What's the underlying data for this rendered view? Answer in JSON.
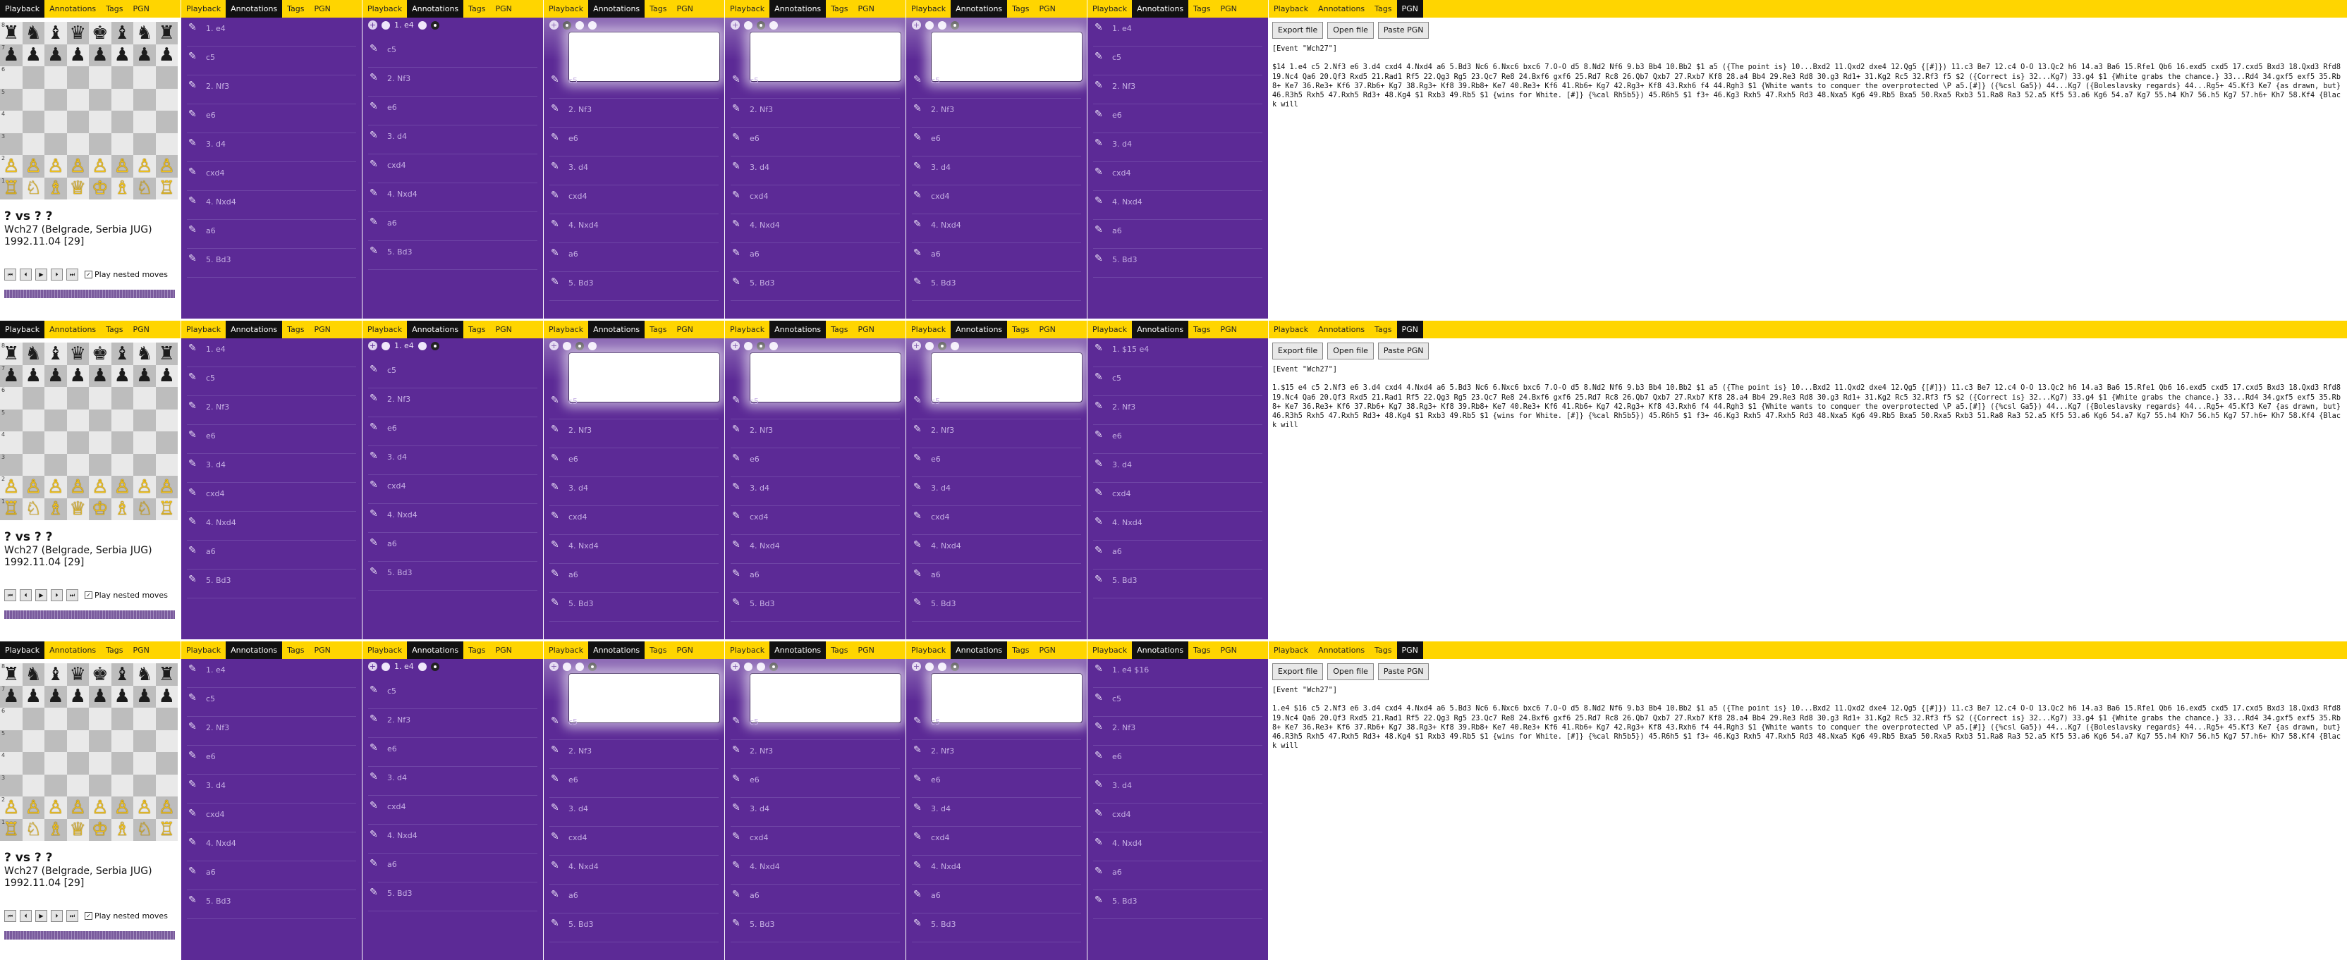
{
  "tabs": [
    "Playback",
    "Annotations",
    "Tags",
    "PGN"
  ],
  "colors": {
    "tab_bar": "#ffd500",
    "tab_active": "#111111",
    "annotation_bg": "#5c2a96",
    "square_light": "#e9e9e9",
    "square_dark": "#bdbdbd"
  },
  "playback": {
    "players": "? vs ? ?",
    "event": "Wch27 (Belgrade, Serbia JUG)",
    "date": "1992.11.04 [29]",
    "buttons": [
      "first",
      "prev",
      "play",
      "next",
      "last"
    ],
    "nested_label": "Play nested moves",
    "nested_checked": true
  },
  "annotation_moves": [
    "1. e4",
    "c5",
    "2. Nf3",
    "e6",
    "3. d4",
    "cxd4",
    "4. Nxd4",
    "a6",
    "5. Bd3"
  ],
  "annotation_header_nag": "$14",
  "pgn": {
    "buttons": {
      "export": "Export file",
      "open": "Open file",
      "paste": "Paste PGN"
    },
    "event_line": "[Event \"Wch27\"]",
    "moves_suffix": " c5 2.Nf3 e6 3.d4 cxd4 4.Nxd4 a6 5.Bd3 Nc6 6.Nxc6 bxc6 7.O-O d5 8.Nd2 Nf6 9.b3 Bb4 10.Bb2 $1 a5 ({The point is} 10...Bxd2 11.Qxd2 dxe4 12.Qg5 {[#]}) 11.c3 Be7 12.c4 O-O 13.Qc2 h6 14.a3 Ba6 15.Rfe1 Qb6 16.exd5 cxd5 17.cxd5 Bxd3 18.Qxd3 Rfd8 19.Nc4 Qa6 20.Qf3 Rxd5 21.Rad1 Rf5 22.Qg3 Rg5 23.Qc7 Re8 24.Bxf6 gxf6 25.Rd7 Rc8 26.Qb7 Qxb7 27.Rxb7 Kf8 28.a4 Bb4 29.Re3 Rd8 30.g3 Rd1+ 31.Kg2 Rc5 32.Rf3 f5 $2 ({Correct is} 32...Kg7) 33.g4 $1 {White grabs the chance.} 33...Rd4 34.gxf5 exf5 35.Rb8+ Ke7 36.Re3+ Kf6 37.Rb6+ Kg7 38.Rg3+ Kf8 39.Rb8+ Ke7 40.Re3+ Kf6 41.Rb6+ Kg7 42.Rg3+ Kf8 43.Rxh6 f4 44.Rgh3 $1 {White wants to conquer the overprotected \\P a5.[#]} ({%csl Ga5}) 44...Kg7 ({Boleslavsky regards} 44...Rg5+ 45.Kf3 Ke7 {as drawn, but} 46.R3h5 Rxh5 47.Rxh5 Rd3+ 48.Kg4 $1 Rxb3 49.Rb5 $1 {wins for White. [#]} {%cal Rh5b5}) 45.R6h5 $1 f3+ 46.Kg3 Rxh5 47.Rxh5 Rd3 48.Nxa5 Kg6 49.Rb5 Bxa5 50.Rxa5 Rxb3 51.Ra8 Ra3 52.a5 Kf5 53.a6 Kg6 54.a7 Kg7 55.h4 Kh7 56.h5 Kg7 57.h6+ Kh7 58.Kf4 {Black will",
    "rows": [
      {
        "prefix": "$14 1.e4"
      },
      {
        "prefix": "1.$15 e4"
      },
      {
        "prefix": "1.e4 $16"
      }
    ]
  },
  "frames_rows": [
    {
      "annotations_variants": [
        {
          "header_state": "nag",
          "header_text": "$14 1. e4",
          "first_move": "1. e4"
        },
        {
          "header_state": "dots",
          "active_dot": 2,
          "first_move": "1. e4"
        },
        {
          "header_state": "editor",
          "active_dot": 0
        },
        {
          "header_state": "editor",
          "active_dot": 1
        },
        {
          "header_state": "editor",
          "active_dot": 2
        },
        {
          "header_state": "nag",
          "header_text": "$14 1. e4",
          "first_move": "1. e4"
        }
      ]
    },
    {
      "annotations_variants": [
        {
          "header_state": "none",
          "first_move": "1. e4"
        },
        {
          "header_state": "dots",
          "active_dot": 2,
          "first_move": "1. e4"
        },
        {
          "header_state": "editor",
          "active_dot": 1
        },
        {
          "header_state": "editor",
          "active_dot": 1
        },
        {
          "header_state": "editor",
          "active_dot": 1
        },
        {
          "header_state": "none",
          "first_move": "1. $15 e4"
        }
      ]
    },
    {
      "annotations_variants": [
        {
          "header_state": "none",
          "first_move": "1. e4"
        },
        {
          "header_state": "dots",
          "active_dot": 2,
          "first_move": "1. e4"
        },
        {
          "header_state": "editor",
          "active_dot": 2
        },
        {
          "header_state": "editor",
          "active_dot": 2
        },
        {
          "header_state": "editor",
          "active_dot": 2
        },
        {
          "header_state": "none",
          "first_move": "1. e4 $16"
        }
      ]
    }
  ],
  "board_rows": [
    [
      "♜",
      "♞",
      "♝",
      "♛",
      "♚",
      "♝",
      "♞",
      "♜"
    ],
    [
      "♟",
      "♟",
      "♟",
      "♟",
      "♟",
      "♟",
      "♟",
      "♟"
    ],
    [
      "",
      "",
      "",
      "",
      "",
      "",
      "",
      ""
    ],
    [
      "",
      "",
      "",
      "",
      "",
      "",
      "",
      ""
    ],
    [
      "",
      "",
      "",
      "",
      "",
      "",
      "",
      ""
    ],
    [
      "",
      "",
      "",
      "",
      "",
      "",
      "",
      ""
    ],
    [
      "♙",
      "♙",
      "♙",
      "♙",
      "♙",
      "♙",
      "♙",
      "♙"
    ],
    [
      "♖",
      "♘",
      "♗",
      "♕",
      "♔",
      "♗",
      "♘",
      "♖"
    ]
  ]
}
